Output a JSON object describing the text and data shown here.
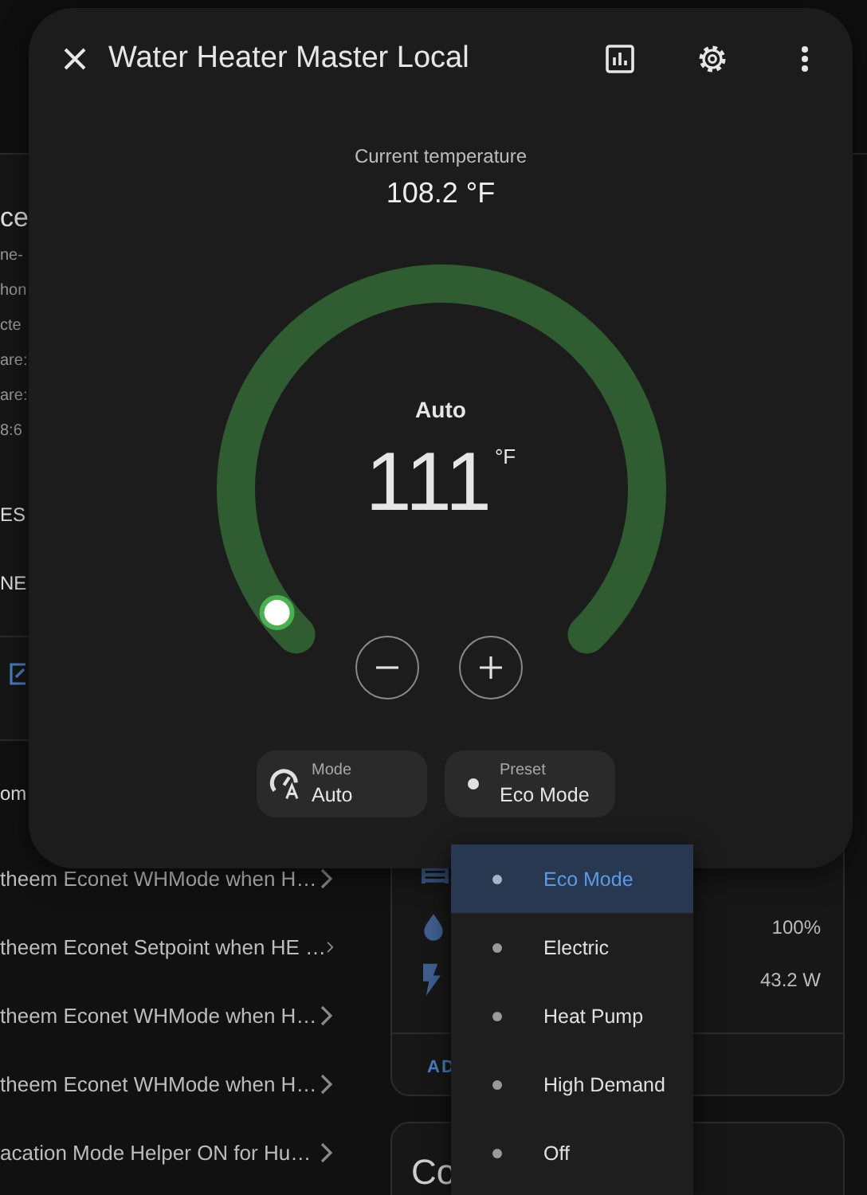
{
  "background": {
    "device_card": {
      "heading": "ce",
      "lines": [
        "ne-",
        "hon",
        "cte",
        "are:",
        "are:",
        "8:6"
      ],
      "items": [
        "ES",
        "NE"
      ]
    },
    "automations": {
      "heading": "om",
      "items": [
        "theem Econet WHMode when H…",
        "theem Econet Setpoint when HE …",
        "theem Econet WHMode when H…",
        "theem Econet WHMode when H…",
        "acation Mode Helper ON for Hu…"
      ]
    },
    "sensor_card": {
      "rows": [
        {
          "kind": "heater"
        },
        {
          "kind": "humidity",
          "value": "100%"
        },
        {
          "kind": "power",
          "value": "43.2 W"
        }
      ],
      "action": "AD"
    },
    "controls_card": {
      "heading": "Co"
    }
  },
  "dialog": {
    "title": "Water Heater Master Local",
    "current_label": "Current temperature",
    "current_value": "108.2 °F",
    "thermostat": {
      "mode": "Auto",
      "target": "111",
      "unit": "°F",
      "level": 0.03
    },
    "chips": [
      {
        "kind": "mode",
        "label": "Mode",
        "value": "Auto"
      },
      {
        "kind": "preset",
        "label": "Preset",
        "value": "Eco Mode"
      }
    ]
  },
  "preset_menu": [
    {
      "label": "Eco Mode",
      "selected": true
    },
    {
      "label": "Electric",
      "selected": false
    },
    {
      "label": "Heat Pump",
      "selected": false
    },
    {
      "label": "High Demand",
      "selected": false
    },
    {
      "label": "Off",
      "selected": false
    }
  ]
}
